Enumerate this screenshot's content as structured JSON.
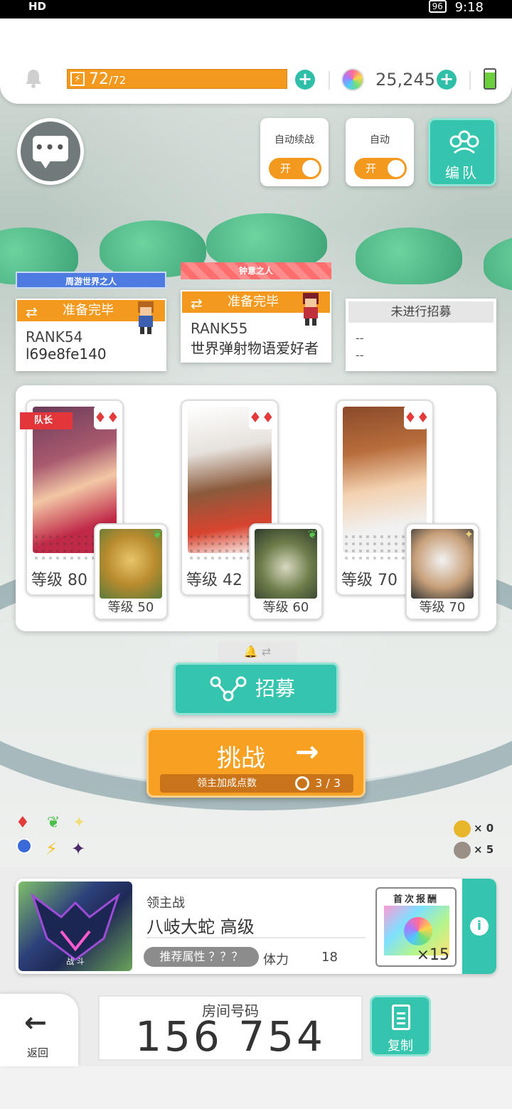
{
  "status_bar": {
    "left": "HD",
    "battery": "96",
    "time": "9:18"
  },
  "resources": {
    "stamina_current": "72",
    "stamina_max": "/72",
    "gems": "25,245",
    "stamina_level": 1.0
  },
  "toggles": [
    {
      "label": "自动续战",
      "state": "开"
    },
    {
      "label": "自动",
      "state": "开"
    }
  ],
  "team_button": {
    "label": "编队"
  },
  "players": [
    {
      "title": "周游世界之人",
      "status": "准备完毕",
      "rank": "RANK54",
      "name": "l69e8fe140"
    },
    {
      "title": "钟意之人",
      "status": "准备完毕",
      "rank": "RANK55",
      "name": "世界弹射物语爱好者"
    },
    {
      "status": "未进行招募",
      "rank": "--",
      "name": "--"
    }
  ],
  "party": {
    "leader_tag": "队长",
    "members": [
      {
        "level": "等级 80",
        "sub_level": "等级 50",
        "suit": "♦♦",
        "sub_elem": "wind"
      },
      {
        "level": "等级 42",
        "sub_level": "等级 60",
        "suit": "♦♦",
        "sub_elem": "wind"
      },
      {
        "level": "等级 70",
        "sub_level": "等级 70",
        "suit": "♦♦",
        "sub_elem": "light"
      }
    ]
  },
  "recruit_button": {
    "label": "招募"
  },
  "challenge_button": {
    "label": "挑战",
    "bonus_label": "领主加成点数",
    "bonus_value": "3 / 3"
  },
  "medals": [
    {
      "count": "× 0",
      "color": "#e8b62a"
    },
    {
      "count": "× 5",
      "color": "#9a8f86"
    }
  ],
  "boss": {
    "type": "领主战",
    "name": "八岐大蛇 高级",
    "image_label": "战 斗",
    "recommend_attr": "推荐属性 ？？？",
    "stamina_label": "体力",
    "stamina_value": "18",
    "reward_title": "首次报酬",
    "reward_count": "×15"
  },
  "room": {
    "label": "房间号码",
    "number": "156 754"
  },
  "back_button": {
    "label": "返回"
  },
  "copy_button": {
    "label": "复制"
  },
  "colors": {
    "accent_teal": "#35c4ae",
    "accent_orange": "#f39a1e",
    "suit_red": "#e43a3a"
  }
}
